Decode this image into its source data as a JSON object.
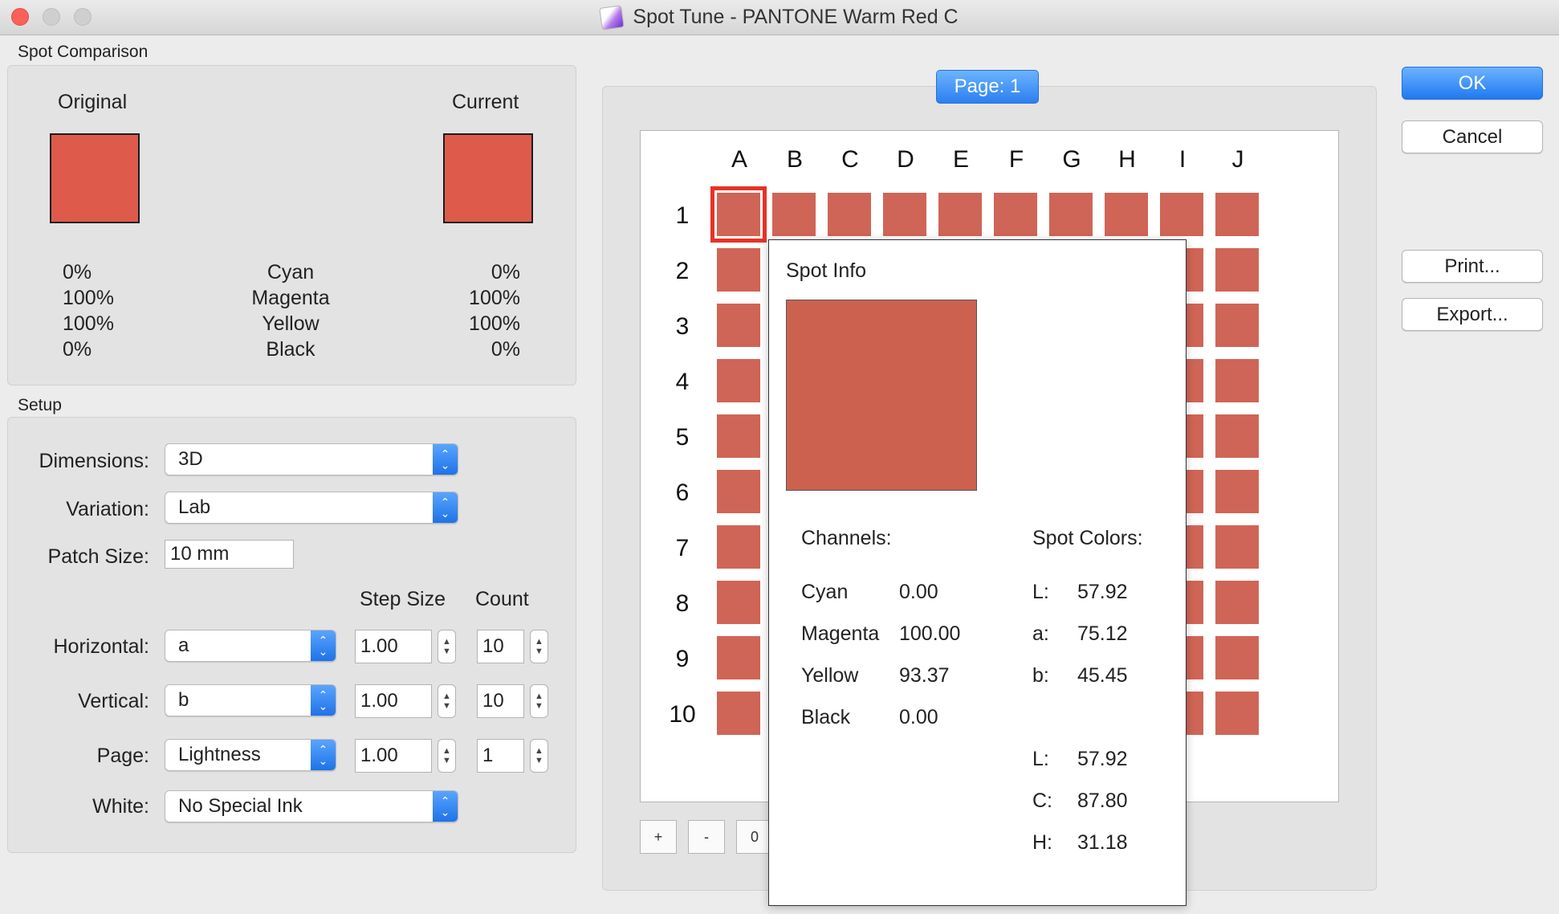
{
  "window": {
    "title": "Spot Tune - PANTONE Warm Red C"
  },
  "spot_comparison": {
    "group_label": "Spot Comparison",
    "original_label": "Original",
    "current_label": "Current",
    "swatch_color": "#de5b4b",
    "channels": [
      {
        "name": "Cyan",
        "original": "0%",
        "current": "0%"
      },
      {
        "name": "Magenta",
        "original": "100%",
        "current": "100%"
      },
      {
        "name": "Yellow",
        "original": "100%",
        "current": "100%"
      },
      {
        "name": "Black",
        "original": "0%",
        "current": "0%"
      }
    ]
  },
  "setup": {
    "group_label": "Setup",
    "dimensions": {
      "label": "Dimensions:",
      "value": "3D"
    },
    "variation": {
      "label": "Variation:",
      "value": "Lab"
    },
    "patch_size": {
      "label": "Patch Size:",
      "value": "10 mm"
    },
    "step_size_header": "Step Size",
    "count_header": "Count",
    "horizontal": {
      "label": "Horizontal:",
      "value": "a",
      "step": "1.00",
      "count": "10"
    },
    "vertical": {
      "label": "Vertical:",
      "value": "b",
      "step": "1.00",
      "count": "10"
    },
    "page": {
      "label": "Page:",
      "value": "Lightness",
      "step": "1.00",
      "count": "1"
    },
    "white": {
      "label": "White:",
      "value": "No Special Ink"
    }
  },
  "preview": {
    "page_badge": "Page: 1",
    "columns": [
      "A",
      "B",
      "C",
      "D",
      "E",
      "F",
      "G",
      "H",
      "I",
      "J"
    ],
    "rows": [
      "1",
      "2",
      "3",
      "4",
      "5",
      "6",
      "7",
      "8",
      "9",
      "10"
    ],
    "patch_color": "#cf6556",
    "zoom_in": "+",
    "zoom_out": "-",
    "zoom_reset": "0"
  },
  "spot_info": {
    "title": "Spot Info",
    "swatch_color": "#cd6150",
    "channels_header": "Channels:",
    "spot_colors_header": "Spot Colors:",
    "channels": [
      {
        "name": "Cyan",
        "value": "0.00"
      },
      {
        "name": "Magenta",
        "value": "100.00"
      },
      {
        "name": "Yellow",
        "value": "93.37"
      },
      {
        "name": "Black",
        "value": "0.00"
      }
    ],
    "lab": [
      {
        "name": "L:",
        "value": "57.92"
      },
      {
        "name": "a:",
        "value": "75.12"
      },
      {
        "name": "b:",
        "value": "45.45"
      }
    ],
    "lch": [
      {
        "name": "L:",
        "value": "57.92"
      },
      {
        "name": "C:",
        "value": "87.80"
      },
      {
        "name": "H:",
        "value": "31.18"
      }
    ]
  },
  "buttons": {
    "ok": "OK",
    "cancel": "Cancel",
    "print": "Print...",
    "export": "Export..."
  }
}
